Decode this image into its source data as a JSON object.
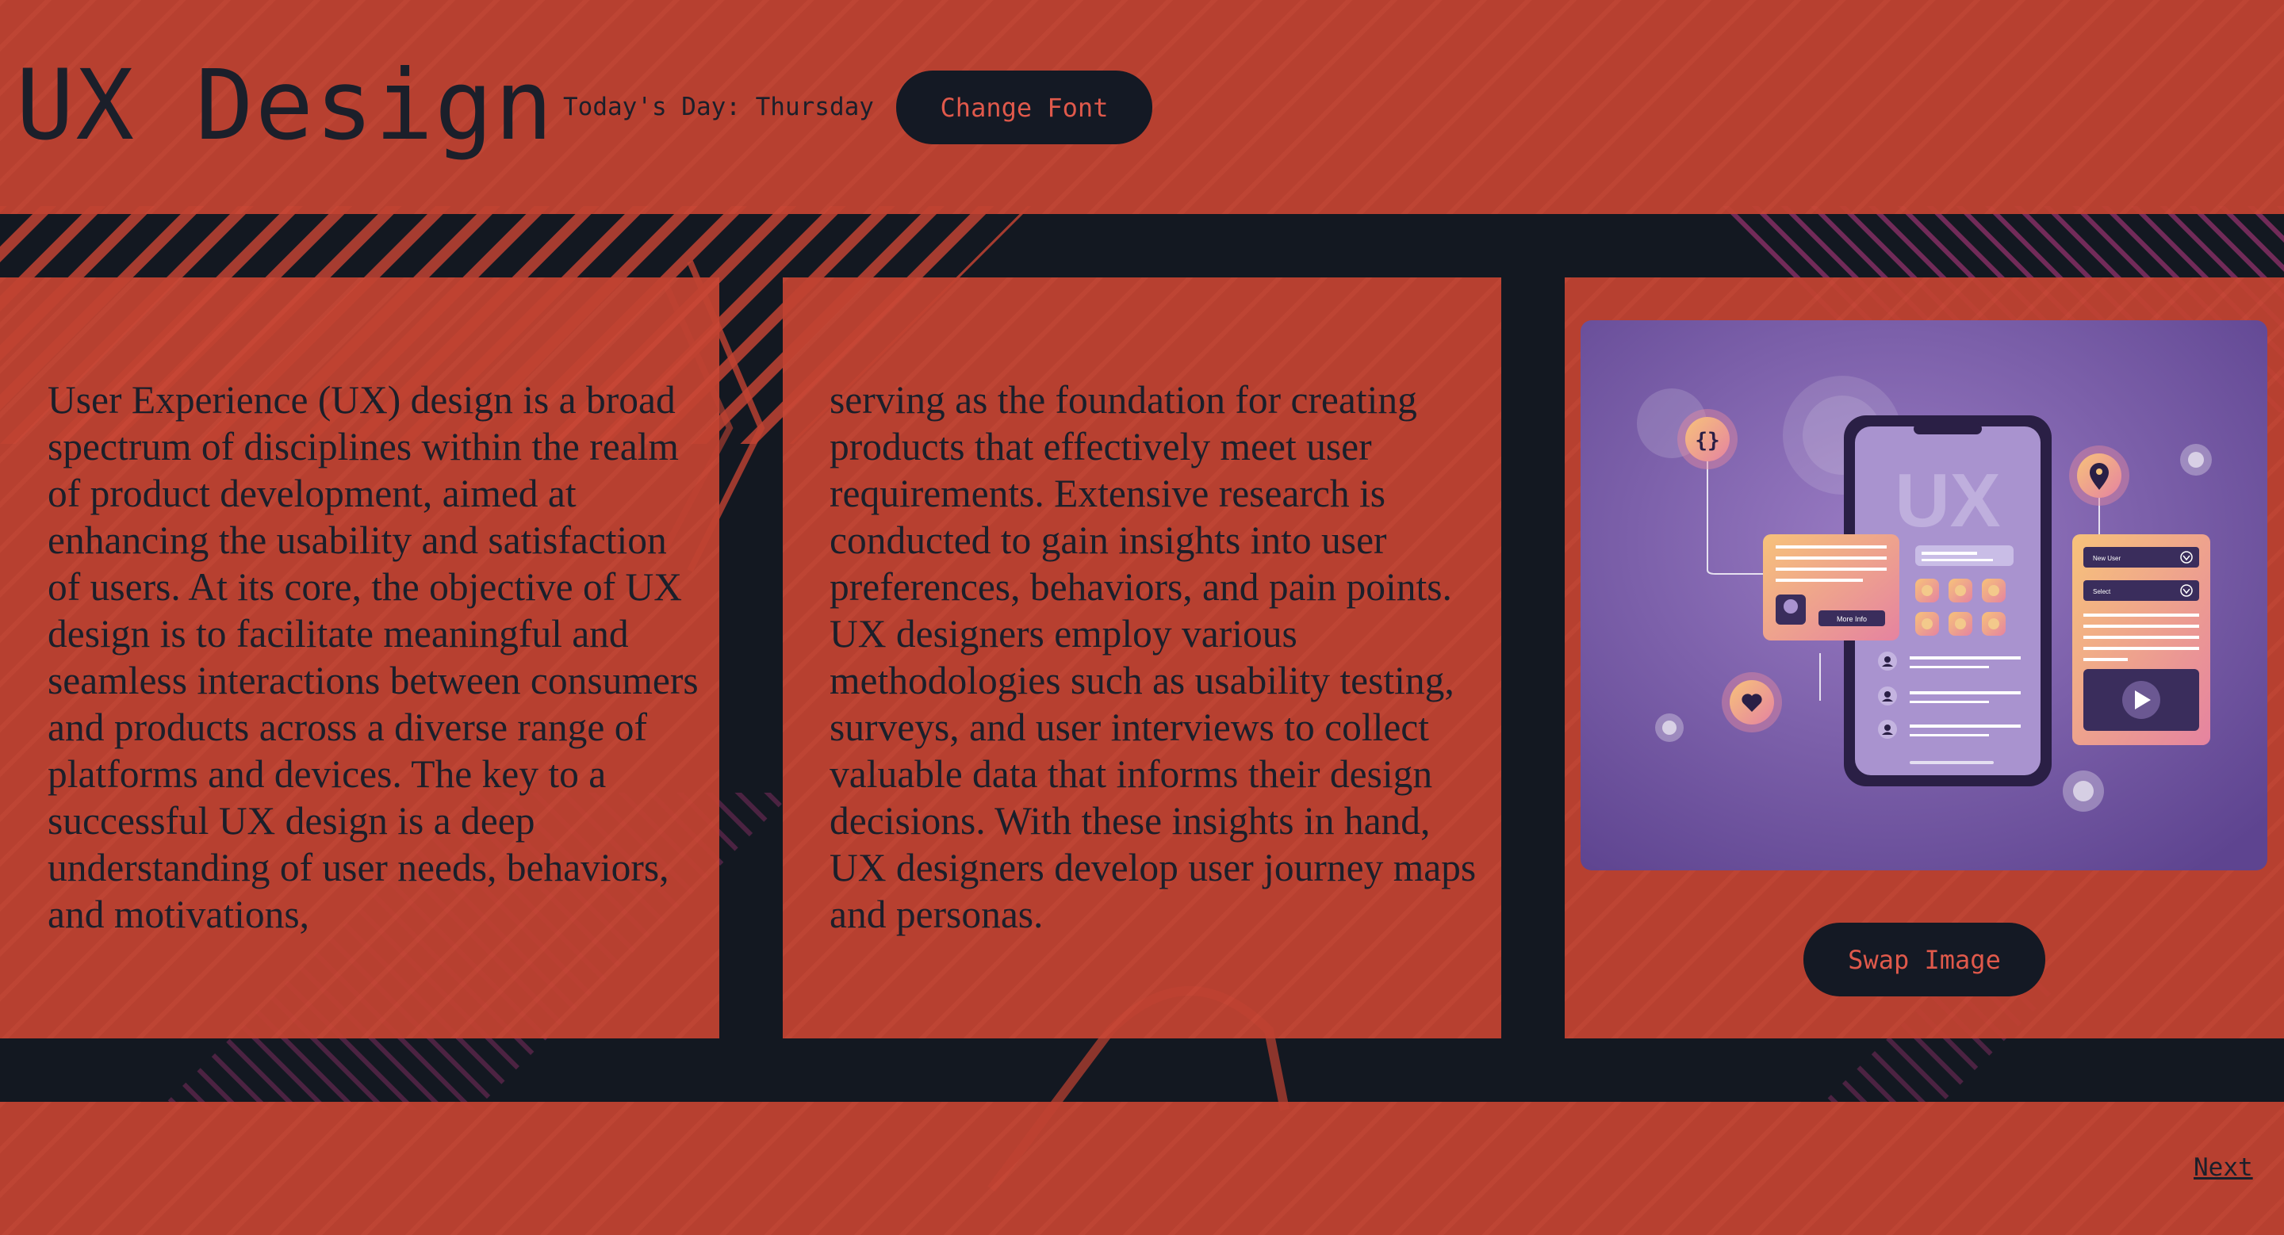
{
  "header": {
    "title": "UX Design",
    "day_text": "Today's Day: Thursday",
    "change_font_label": "Change Font"
  },
  "content": {
    "paragraph_1": "User Experience (UX) design is a broad spectrum of disciplines within the realm of product development, aimed at enhancing the usability and satisfaction of users. At its core, the objective of UX design is to facilitate meaningful and seamless interactions between consumers and products across a diverse range of platforms and devices. The key to a successful UX design is a deep understanding of user needs, behaviors, and motivations,",
    "paragraph_2": "serving as the foundation for creating products that effectively meet user requirements. Extensive research is conducted to gain insights into user preferences, behaviors, and pain points. UX designers employ various methodologies such as usability testing, surveys, and user interviews to collect valuable data that informs their design decisions. With these insights in hand, UX designers develop user journey maps and personas."
  },
  "illustration": {
    "phone_logo": "UX",
    "card_button": "More Info",
    "select_1": "New User",
    "select_2": "Select"
  },
  "swap_image_label": "Swap Image",
  "footer": {
    "next_label": "Next"
  },
  "colors": {
    "panel": "#c04232",
    "dark": "#141924",
    "button_text": "#e0594b",
    "text": "#1b1f2a",
    "illustration_bg": "#6a4f9a"
  },
  "icons": [
    "code-braces-icon",
    "heart-icon",
    "location-pin-icon",
    "user-icon",
    "play-icon",
    "chevron-down-icon"
  ]
}
